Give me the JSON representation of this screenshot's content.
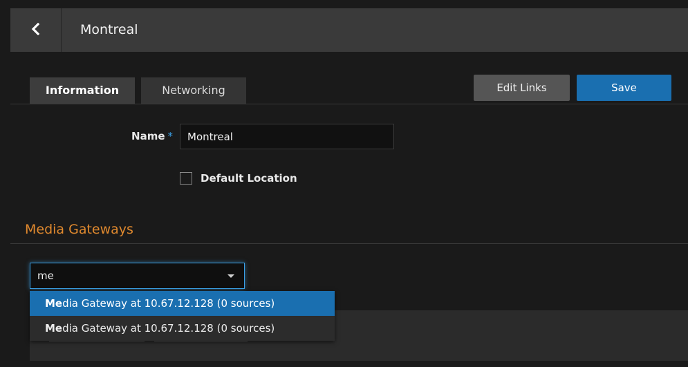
{
  "header": {
    "title": "Montreal",
    "back_icon": "chevron-left-icon"
  },
  "tabs": [
    {
      "label": "Information",
      "active": true
    },
    {
      "label": "Networking",
      "active": false
    }
  ],
  "actions": {
    "edit_links_label": "Edit Links",
    "save_label": "Save"
  },
  "form": {
    "name_label": "Name",
    "required_marker": "*",
    "name_value": "Montreal",
    "default_location_label": "Default Location",
    "default_location_checked": false
  },
  "media_gateways": {
    "section_title": "Media Gateways",
    "search_value": "me",
    "options": [
      {
        "match": "Me",
        "rest": "dia Gateway at 10.67.12.128 (0 sources)",
        "highlighted": true
      },
      {
        "match": "Me",
        "rest": "dia Gateway at 10.67.12.128 (0 sources)",
        "highlighted": false
      }
    ]
  },
  "colors": {
    "accent": "#1a6fb0",
    "section_title": "#e0892e",
    "focus": "#3aa0e6"
  }
}
